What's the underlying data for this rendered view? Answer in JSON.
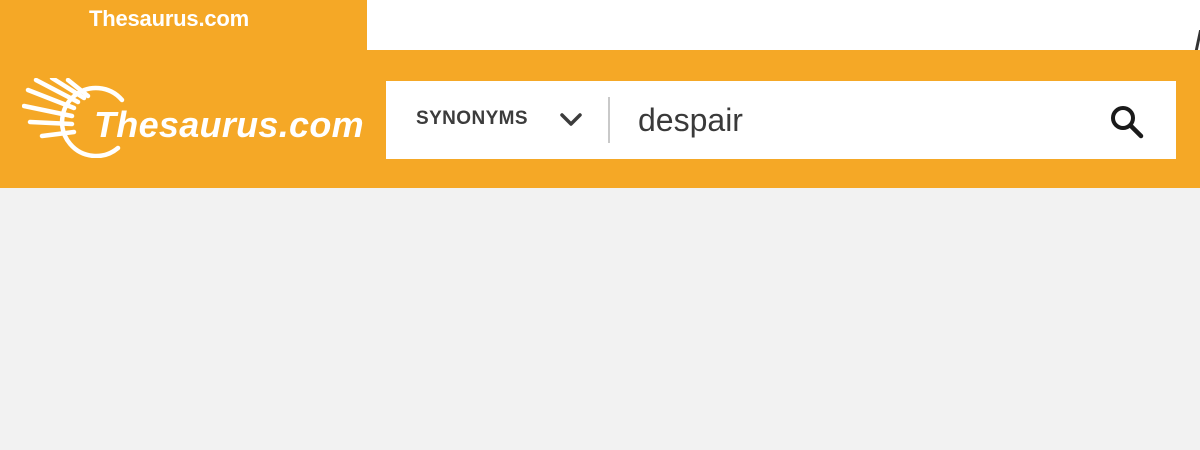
{
  "browser_tab": {
    "title": "Thesaurus.com"
  },
  "header": {
    "logo_text": "Thesaurus.com",
    "logo_icon": "sunburst-logo-icon",
    "background_color": "#f5a826"
  },
  "search": {
    "type_label": "SYNONYMS",
    "type_icon": "chevron-down-icon",
    "query": "despair",
    "submit_icon": "search-icon"
  },
  "page": {
    "background_color": "#f2f2f2"
  }
}
